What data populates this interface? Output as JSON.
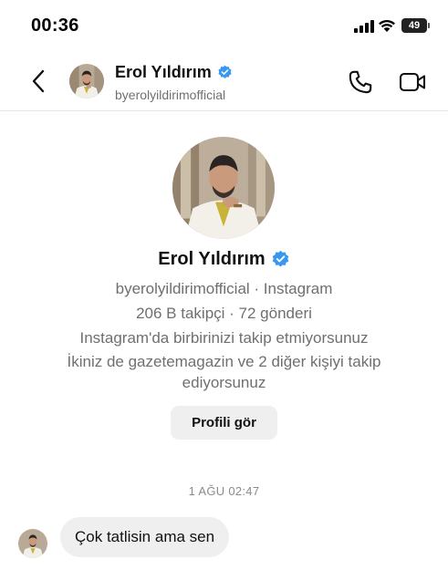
{
  "status_bar": {
    "time": "00:36",
    "battery": "49"
  },
  "header": {
    "name": "Erol Yıldırım",
    "handle": "byerolyildirimofficial",
    "verified_icon": "verified-badge-icon",
    "back_icon": "chevron-left-icon",
    "call_icon": "phone-icon",
    "video_icon": "video-camera-icon"
  },
  "profile": {
    "name": "Erol Yıldırım",
    "handle_source": "byerolyildirimofficial · Instagram",
    "stats": "206 B takipçi · 72 gönderi",
    "follow_status": "Instagram'da birbirinizi takip etmiyorsunuz",
    "mutual_line1": "İkiniz de gazetemagazin ve 2 diğer kişiyi takip",
    "mutual_line2": "ediyorsunuz",
    "view_profile_label": "Profili gör"
  },
  "conversation": {
    "timestamp": "1 AĞU 02:47",
    "messages": [
      {
        "sender": "Erol Yıldırım",
        "text": "Çok tatlisin ama sen"
      }
    ]
  },
  "colors": {
    "verified_blue": "#3897f0",
    "bubble_bg": "#efefef",
    "secondary_text": "#6f6f6f"
  }
}
